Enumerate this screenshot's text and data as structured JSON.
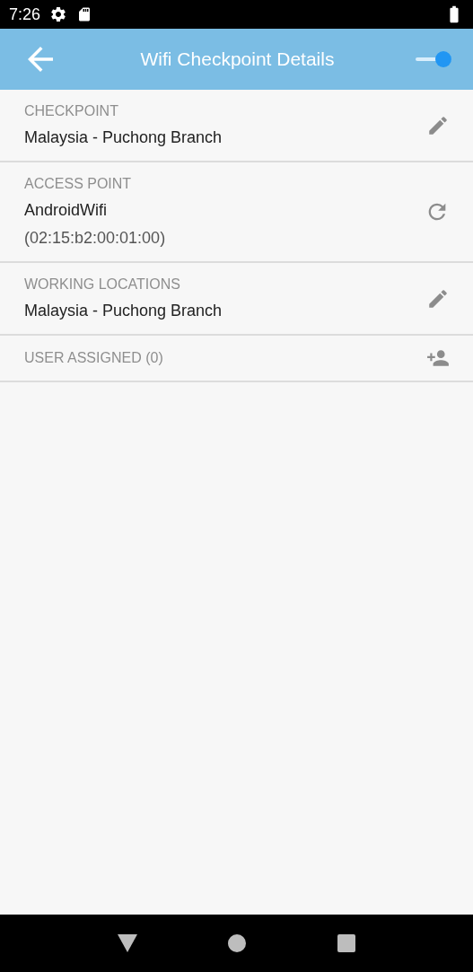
{
  "status_bar": {
    "time": "7:26"
  },
  "toolbar": {
    "title": "Wifi Checkpoint Details",
    "switch": {
      "on": true
    }
  },
  "rows": [
    {
      "label": "CHECKPOINT",
      "values": [
        "Malaysia - Puchong Branch"
      ],
      "kind": "edit"
    },
    {
      "label": "ACCESS POINT",
      "values": [
        "AndroidWifi",
        "(02:15:b2:00:01:00)"
      ],
      "kind": "refresh"
    },
    {
      "label": "WORKING LOCATIONS",
      "values": [
        "Malaysia - Puchong Branch"
      ],
      "kind": "edit"
    },
    {
      "label": "USER ASSIGNED (0)",
      "values": [],
      "kind": "add-user"
    }
  ]
}
